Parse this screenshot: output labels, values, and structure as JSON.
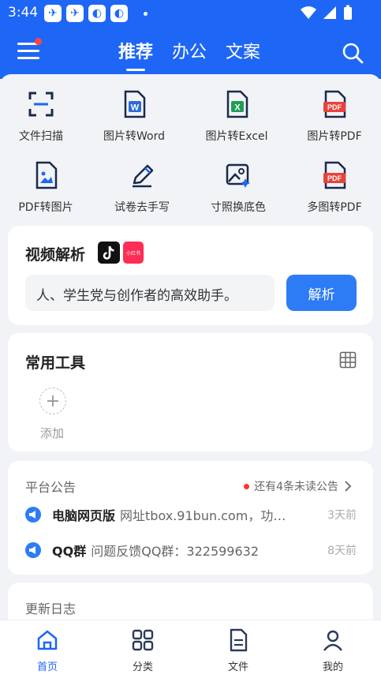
{
  "status_bar": {
    "time": "3:44"
  },
  "header": {
    "tabs": [
      "推荐",
      "办公",
      "文案"
    ],
    "active_tab": 0
  },
  "tools": [
    {
      "label": "文件扫描",
      "icon": "scan-icon"
    },
    {
      "label": "图片转Word",
      "icon": "word-file-icon"
    },
    {
      "label": "图片转Excel",
      "icon": "excel-file-icon"
    },
    {
      "label": "图片转PDF",
      "icon": "pdf-file-icon"
    },
    {
      "label": "PDF转图片",
      "icon": "image-file-icon"
    },
    {
      "label": "试卷去手写",
      "icon": "pen-icon"
    },
    {
      "label": "寸照换底色",
      "icon": "photo-edit-icon"
    },
    {
      "label": "多图转PDF",
      "icon": "multi-pdf-icon"
    }
  ],
  "pdf_badge": "PDF",
  "word_badge": "W",
  "excel_badge": "X",
  "video": {
    "title": "视频解析",
    "badge_label": "小红书",
    "input_text": "人、学生党与创作者的高效助手。",
    "button": "解析"
  },
  "common_tools": {
    "title": "常用工具",
    "add_label": "添加"
  },
  "notice": {
    "title": "平台公告",
    "unread": "还有4条未读公告",
    "items": [
      {
        "title": "电脑网页版",
        "text": "网址tbox.91bun.com，功…",
        "time": "3天前"
      },
      {
        "title": "QQ群",
        "text": "问题反馈QQ群：322599632",
        "time": "8天前"
      }
    ]
  },
  "changelog": {
    "title": "更新日志"
  },
  "nav": {
    "items": [
      {
        "label": "首页",
        "icon": "home-icon"
      },
      {
        "label": "分类",
        "icon": "category-icon"
      },
      {
        "label": "文件",
        "icon": "file-icon"
      },
      {
        "label": "我的",
        "icon": "profile-icon"
      }
    ],
    "active": 0
  },
  "colors": {
    "primary": "#1e66f5",
    "button": "#2d7cf6",
    "pdf": "#e8433b",
    "excel": "#1f9d55",
    "word": "#2d6bd6"
  }
}
